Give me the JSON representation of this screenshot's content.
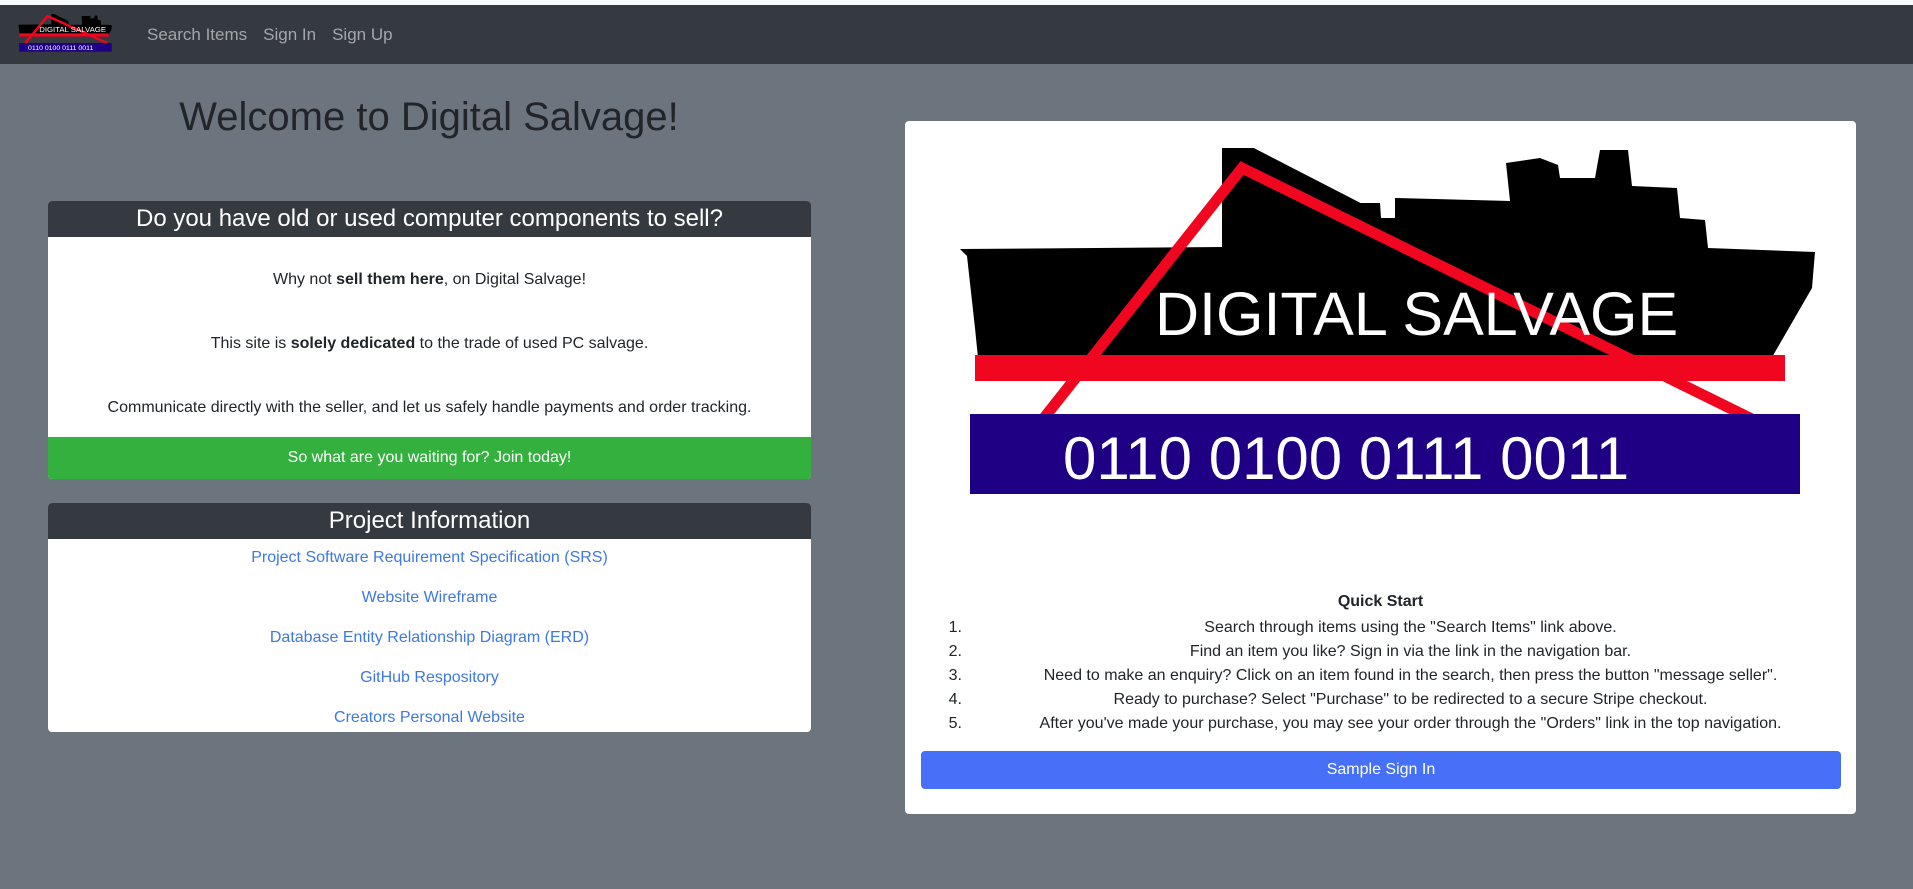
{
  "navbar": {
    "logo": {
      "line1": "DIGITAL SALVAGE",
      "line2": "0110 0100  0111 0011"
    },
    "links": [
      "Search Items",
      "Sign In",
      "Sign Up"
    ]
  },
  "hero": {
    "title": "Welcome to Digital Salvage!"
  },
  "sell_card": {
    "header": "Do you have old or used computer components to sell?",
    "p1_before": "Why not ",
    "p1_bold": "sell them here",
    "p1_after": ", on Digital Salvage!",
    "p2_before": "This site is ",
    "p2_bold": "solely dedicated",
    "p2_after": " to the trade of used PC salvage.",
    "p3": "Communicate directly with the seller, and let us safely handle payments and order tracking.",
    "cta": "So what are you waiting for? Join today!"
  },
  "project_card": {
    "header": "Project Information",
    "links": [
      "Project Software Requirement Specification (SRS)",
      "Website Wireframe",
      "Database Entity Relationship Diagram (ERD)",
      "GitHub Respository",
      "Creators Personal Website"
    ]
  },
  "logo_card": {
    "logo": {
      "title": "DIGITAL SALVAGE",
      "binary": "0110 0100  0111 0011"
    },
    "quick_start_title": "Quick Start",
    "steps": [
      "Search through items using the \"Search Items\" link above.",
      "Find an item you like? Sign in via the link in the navigation bar.",
      "Need to make an enquiry? Click on an item found in the search, then press the button \"message seller\".",
      "Ready to purchase? Select \"Purchase\" to be redirected to a secure Stripe checkout.",
      "After you've made your purchase, you may see your order through the \"Orders\" link in the top navigation."
    ],
    "sample_signin": "Sample Sign In"
  },
  "colors": {
    "navbar": "#343a40",
    "page_bg": "#6c757d",
    "join_green": "#34b03e",
    "link_blue": "#3d78e3",
    "signin_blue": "#4670f8",
    "logo_red": "#f0061e",
    "logo_navy": "#1f0084"
  }
}
